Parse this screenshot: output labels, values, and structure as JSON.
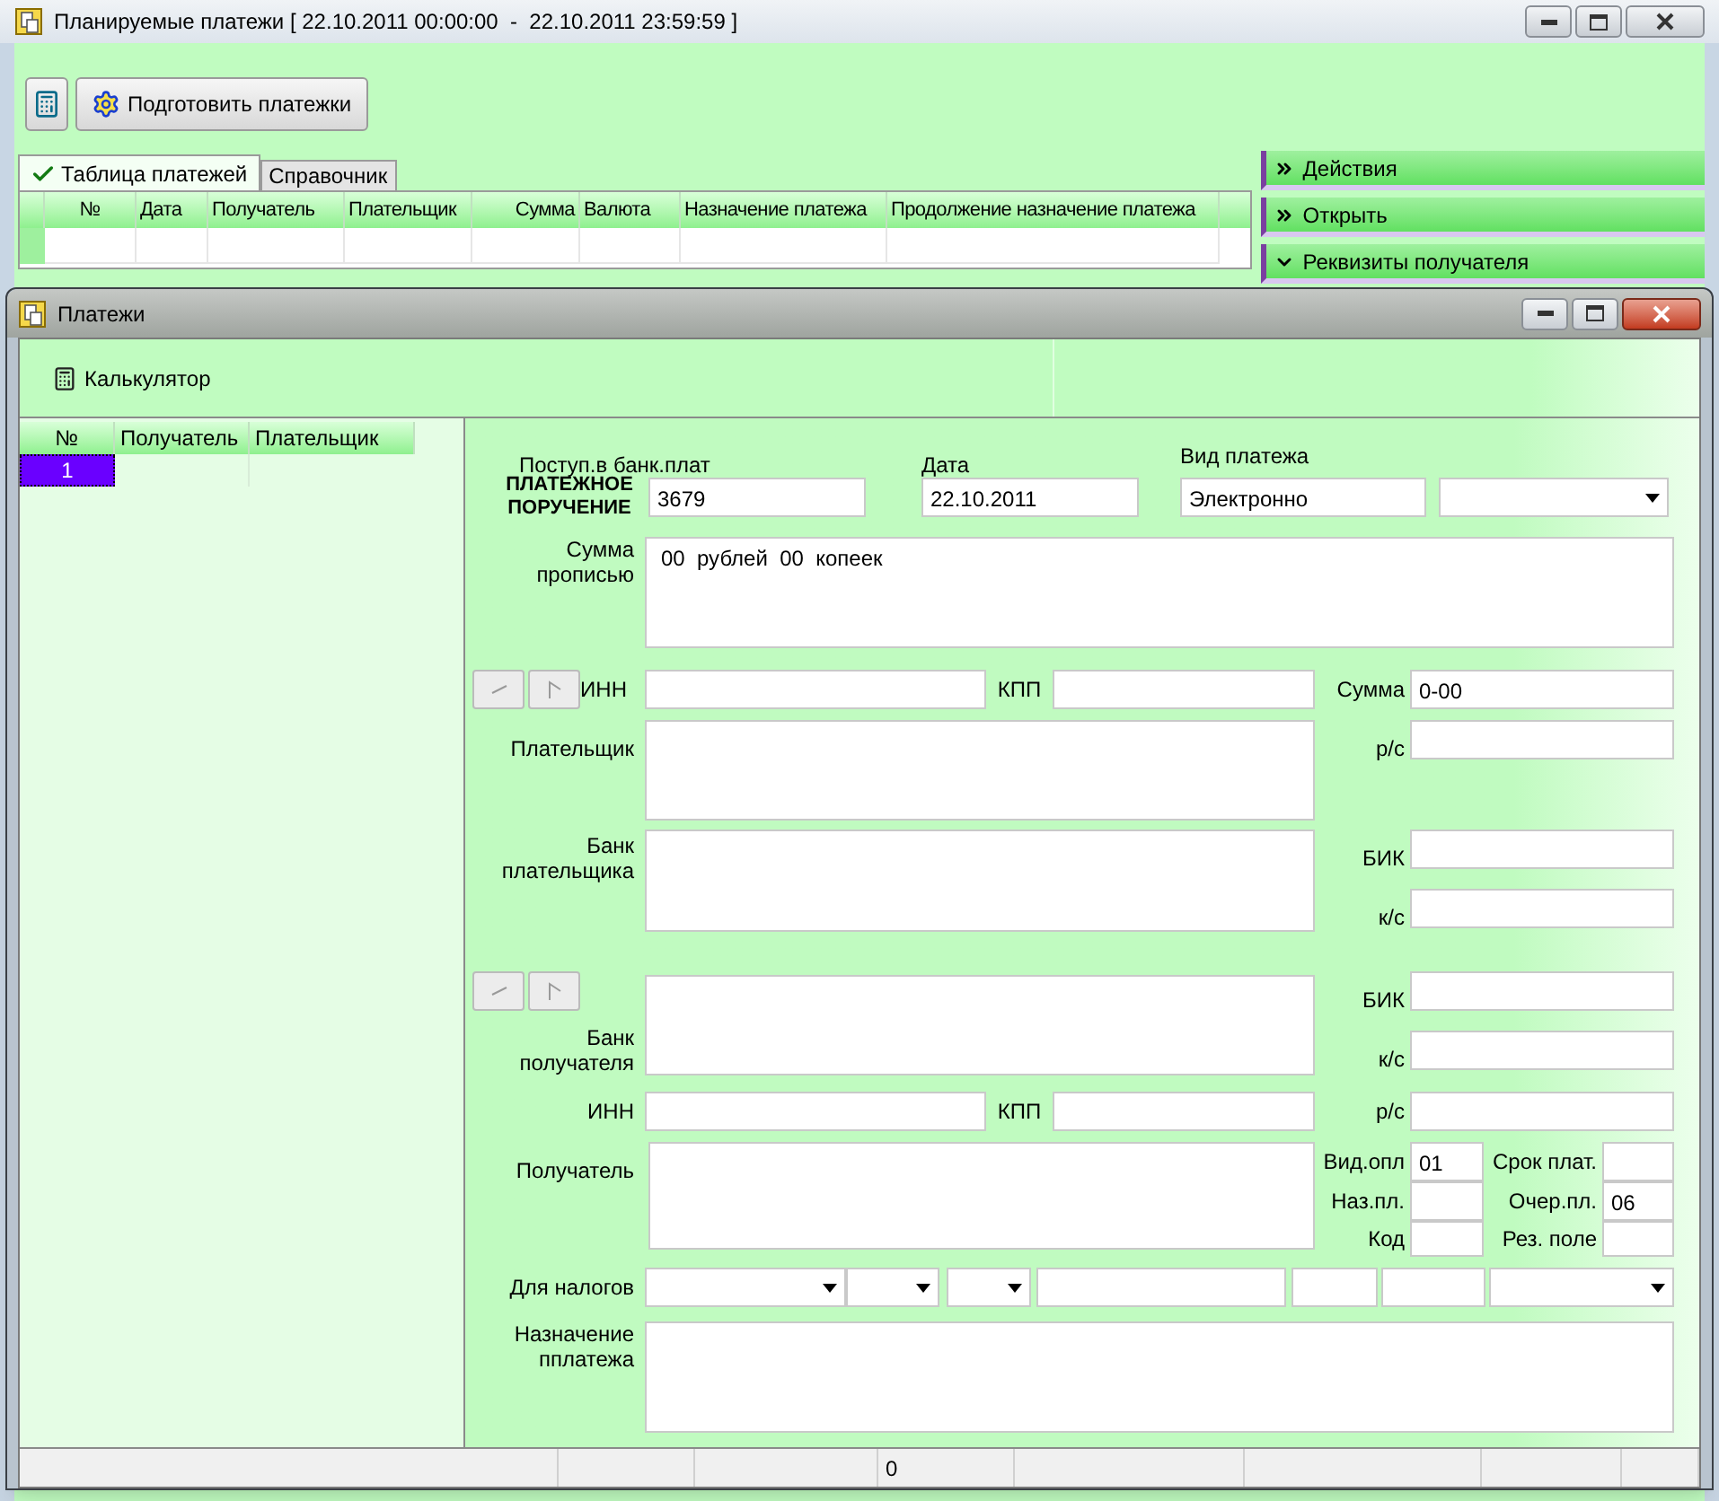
{
  "main_window": {
    "title": "Планируемые платежи [ 22.10.2011 00:00:00  -  22.10.2011 23:59:59 ]",
    "prepare_button": "Подготовить платежки",
    "tabs": [
      {
        "label": "Таблица платежей",
        "selected": true
      },
      {
        "label": "Справочник",
        "selected": false
      }
    ],
    "table": {
      "columns": [
        "№",
        "Дата",
        "Получатель",
        "Плательщик",
        "Сумма",
        "Валюта",
        "Назначение платежа",
        "Продолжение назначение платежа"
      ]
    },
    "side_panel": {
      "items": [
        {
          "label": "Действия",
          "expanded": false
        },
        {
          "label": "Открыть",
          "expanded": false
        },
        {
          "label": "Реквизиты получателя",
          "expanded": true
        }
      ]
    }
  },
  "payments_window": {
    "title": "Платежи",
    "calculator_button": "Калькулятор",
    "list": {
      "columns": [
        "№",
        "Получатель",
        "Плательщик"
      ],
      "rows": [
        {
          "number": "1",
          "selected": true
        }
      ]
    }
  },
  "form": {
    "received_label": "Поступ.в банк.плат",
    "date_label": "Дата",
    "payment_type_label": "Вид платежа",
    "doc_label": "ПЛАТЕЖНОЕ ПОРУЧЕНИЕ",
    "number": "3679",
    "date": "22.10.2011",
    "payment_type": "Электронно",
    "amount_words_label": "Сумма прописью",
    "amount_words": "00  рублей  00  копеек",
    "payer_inn_label": "ИНН",
    "payer_kpp_label": "КПП",
    "amount_label": "Сумма",
    "amount": "0-00",
    "payer_label": "Плательщик",
    "payer_account_label": "р/с",
    "payer_bank_label": "Банк плательщика",
    "payer_bik_label": "БИК",
    "payer_ks_label": "к/с",
    "recipient_bank_label": "Банк получателя",
    "recipient_bik_label": "БИК",
    "recipient_ks_label": "к/с",
    "recipient_inn_label": "ИНН",
    "recipient_kpp_label": "КПП",
    "recipient_account_label": "р/с",
    "recipient_label": "Получатель",
    "op_type_label": "Вид.опл",
    "op_type": "01",
    "term_label": "Срок плат.",
    "purpose_code_label": "Наз.пл.",
    "priority_label": "Очер.пл.",
    "priority": "06",
    "code_label": "Код",
    "reserve_label": "Рез. поле",
    "tax_label": "Для налогов",
    "purpose_label": "Назначение пплатежа"
  },
  "status_bar": {
    "count": "0"
  }
}
